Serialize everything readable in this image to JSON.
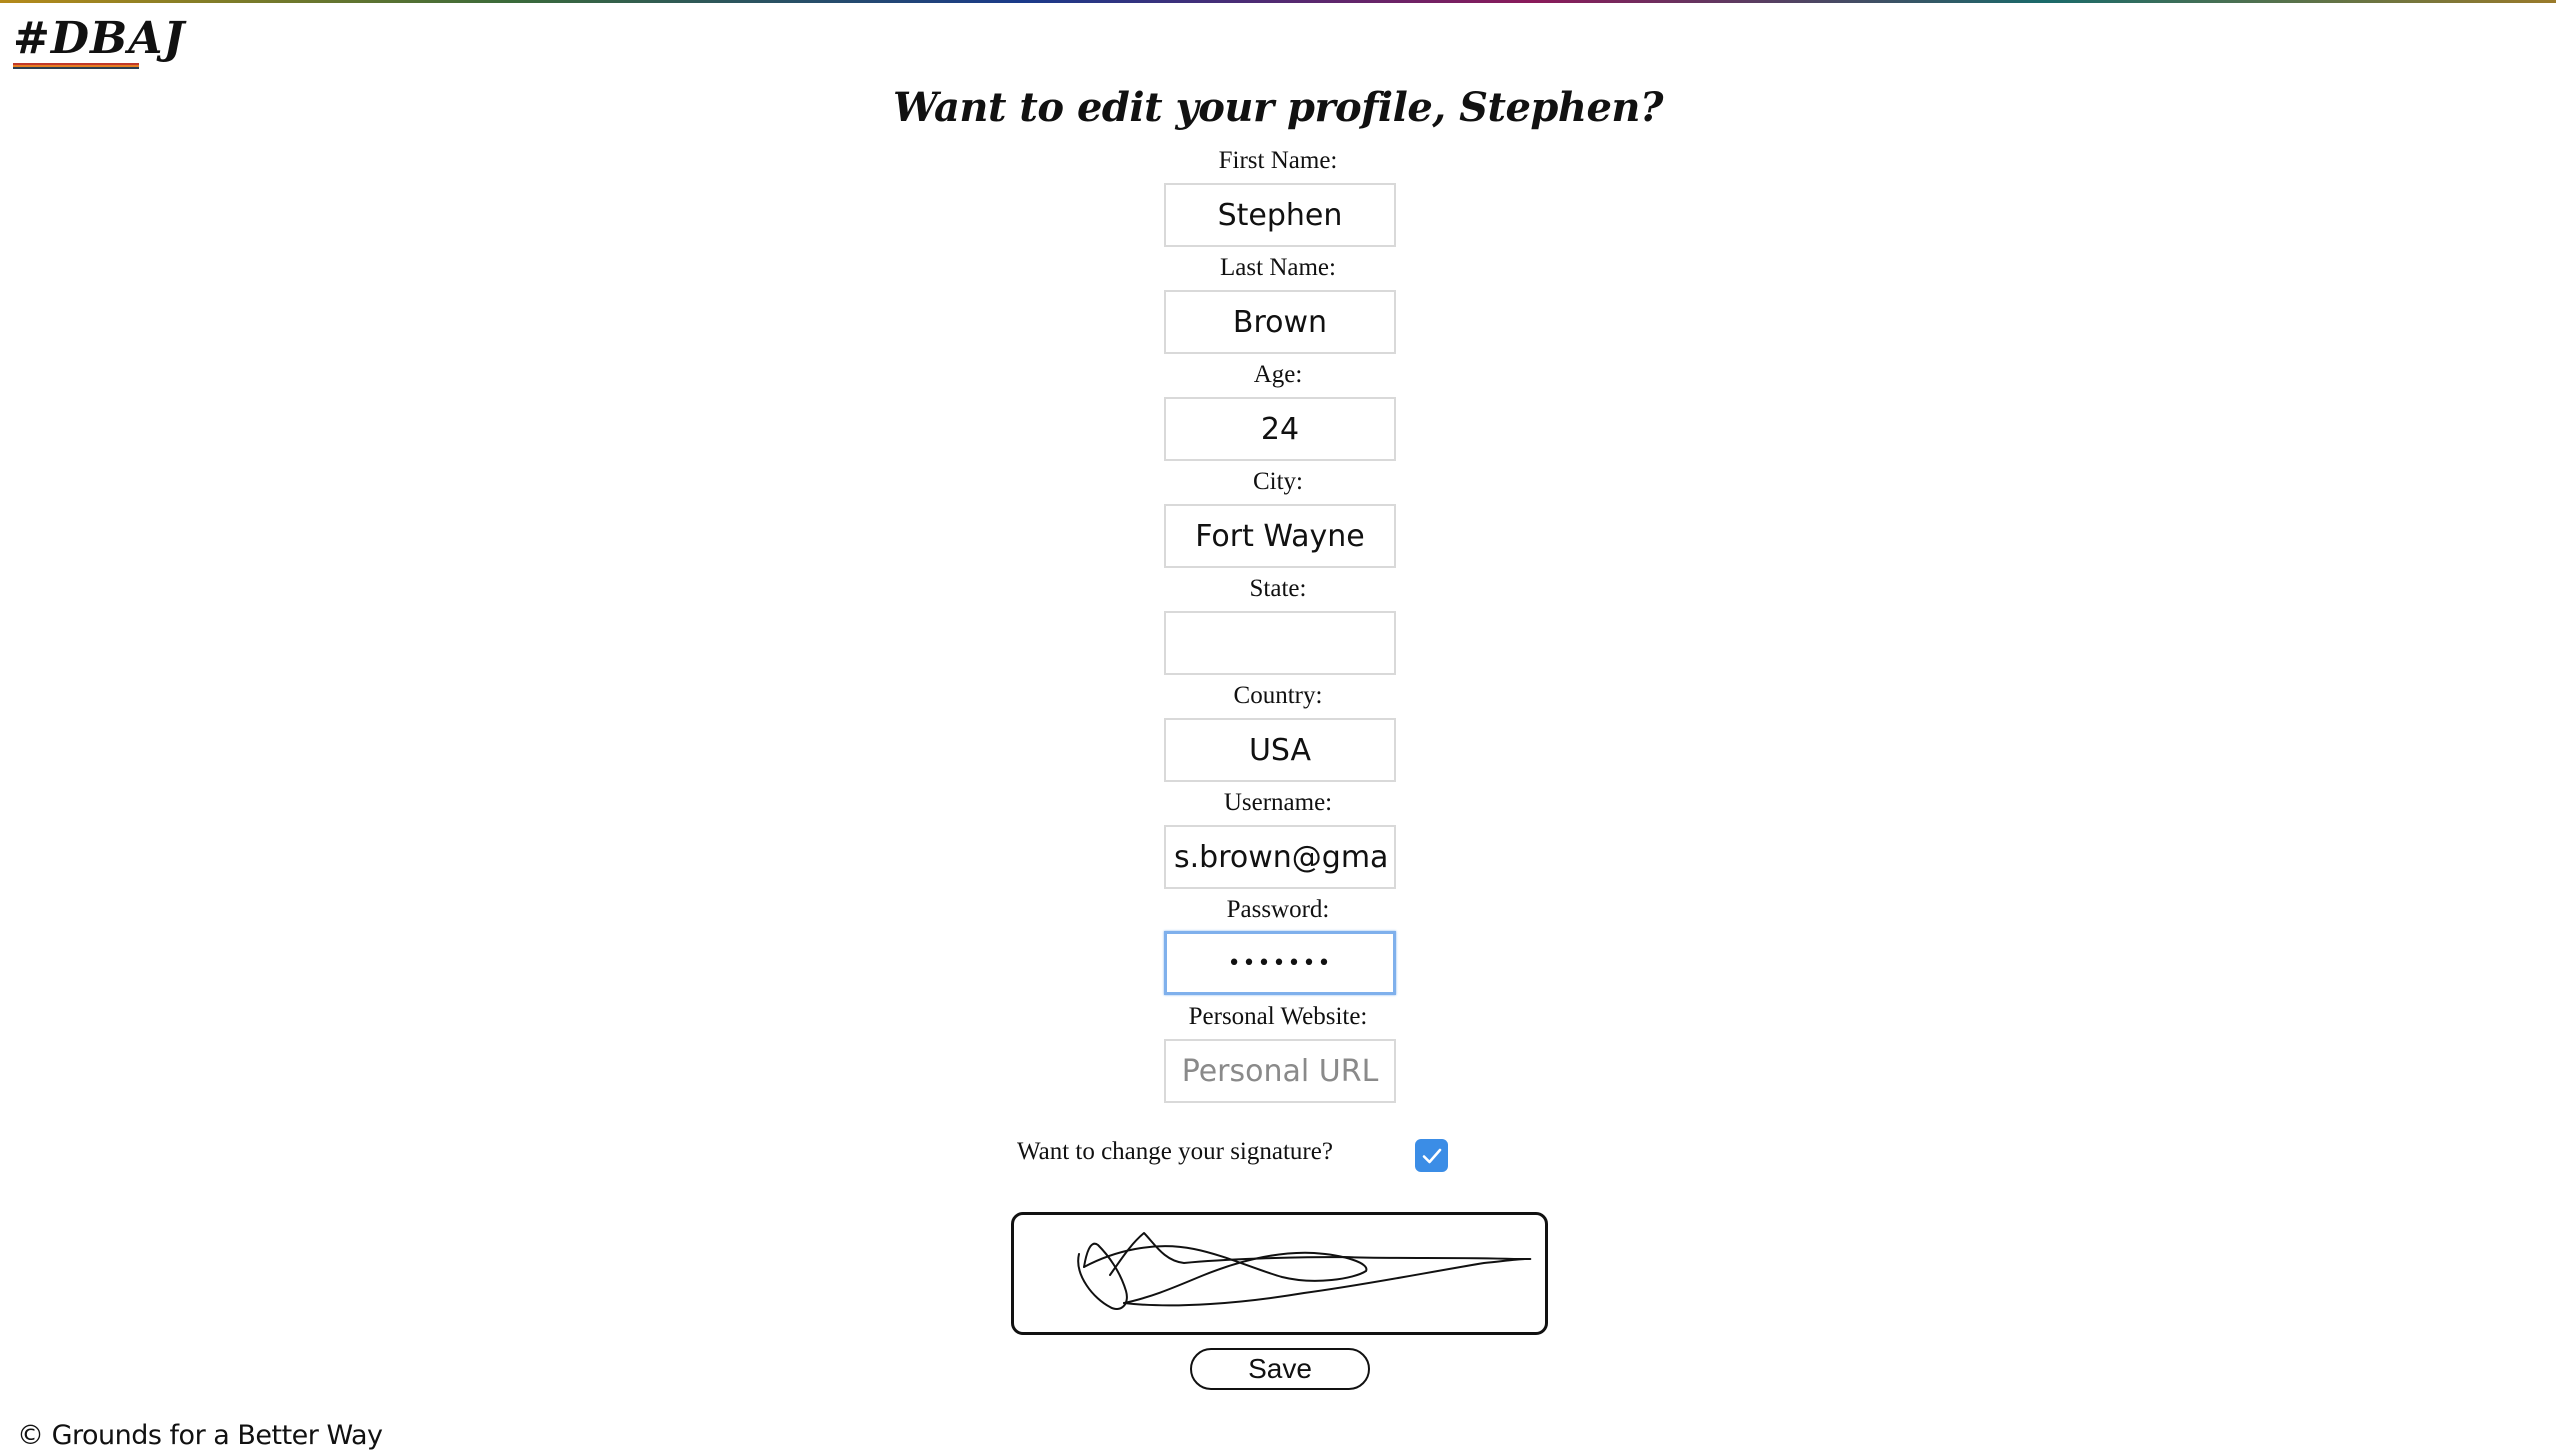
{
  "header": {
    "logo_text": "#DBAJ",
    "logo_stripe_colors": [
      "#c0392b",
      "#e67e22",
      "#2c3e50"
    ]
  },
  "page": {
    "heading": "Want to edit your profile, Stephen?"
  },
  "form": {
    "fields": [
      {
        "label": "First Name:",
        "value": "Stephen",
        "placeholder": ""
      },
      {
        "label": "Last Name:",
        "value": "Brown",
        "placeholder": ""
      },
      {
        "label": "Age:",
        "value": "24",
        "placeholder": ""
      },
      {
        "label": "City:",
        "value": "Fort Wayne",
        "placeholder": ""
      },
      {
        "label": "State:",
        "value": "",
        "placeholder": ""
      },
      {
        "label": "Country:",
        "value": "USA",
        "placeholder": ""
      },
      {
        "label": "Username:",
        "value": "s.brown@gmail.com",
        "placeholder": ""
      },
      {
        "label": "Password:",
        "value": "•••••••",
        "placeholder": ""
      },
      {
        "label": "Personal Website:",
        "value": "",
        "placeholder": "Personal URL"
      }
    ],
    "signature_question": "Want to change your signature?",
    "signature_checked": true,
    "save_label": "Save"
  },
  "footer": {
    "copyright": "© Grounds for a Better Way"
  },
  "colors": {
    "checkbox_accent": "#3b8de6",
    "focus_ring": "#7fb0ec"
  }
}
